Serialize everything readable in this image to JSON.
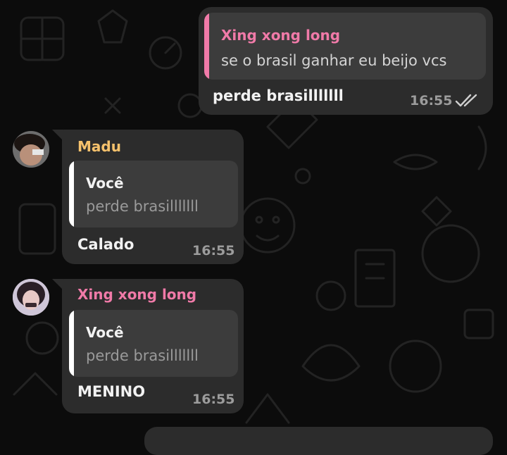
{
  "messages": [
    {
      "direction": "outgoing",
      "quote": {
        "author": "Xing xong long",
        "text": "se o brasil ganhar eu beijo vcs"
      },
      "text": "perde brasilllllll",
      "time": "16:55",
      "status_icon": "double-check-icon"
    },
    {
      "direction": "incoming",
      "sender": "Madu",
      "quote": {
        "author": "Você",
        "text": "perde brasilllllll"
      },
      "text": "Calado",
      "time": "16:55",
      "avatar_icon": "avatar"
    },
    {
      "direction": "incoming",
      "sender": "Xing xong long",
      "quote": {
        "author": "Você",
        "text": "perde brasilllllll"
      },
      "text": "MENINO",
      "time": "16:55",
      "avatar_icon": "avatar"
    }
  ],
  "colors": {
    "background": "#0c0c0c",
    "bubble": "#2c2c2c",
    "quote_background": "#3c3c3c",
    "pink_accent": "#f07aa8",
    "madu_name": "#f5c16c",
    "quote_bar_white": "#ffffff"
  }
}
